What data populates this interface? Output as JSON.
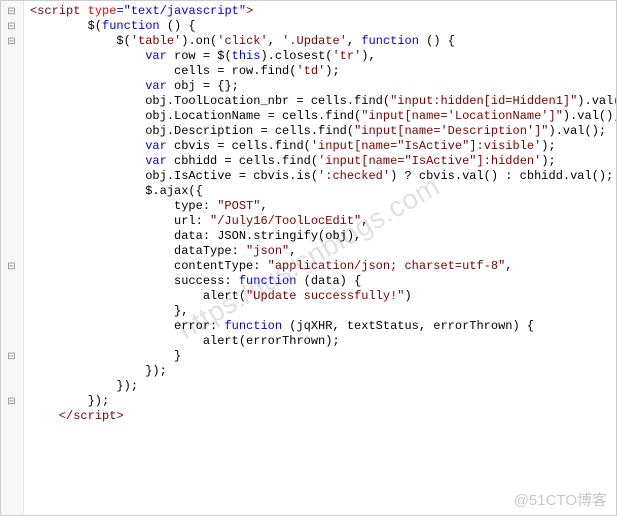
{
  "folds": [
    "⊟",
    "⊟",
    "⊟",
    "",
    "",
    "",
    "",
    "",
    "",
    "",
    "",
    "",
    "",
    "",
    "",
    "",
    "",
    "⊟",
    "",
    "",
    "",
    "",
    "",
    "⊟",
    "",
    "",
    "⊟",
    "",
    "",
    "",
    "",
    "",
    ""
  ],
  "code": {
    "l1": {
      "a": "<",
      "b": "script",
      "c": " ",
      "d": "type",
      "e": "=\"text/javascript\"",
      "f": ">"
    },
    "l2": {
      "a": "        $(",
      "b": "function",
      "c": " () {"
    },
    "l3": {
      "a": "            $(",
      "b": "'table'",
      "c": ").on(",
      "d": "'click'",
      "e": ", ",
      "f": "'.Update'",
      "g": ", ",
      "h": "function",
      "i": " () {"
    },
    "l4": {
      "a": "                ",
      "b": "var",
      "c": " row = $(",
      "d": "this",
      "e": ").closest(",
      "f": "'tr'",
      "g": "),"
    },
    "l5": {
      "a": "                    cells = row.find(",
      "b": "'td'",
      "c": ");"
    },
    "l6": "",
    "l7": {
      "a": "                ",
      "b": "var",
      "c": " obj = {};"
    },
    "l8": {
      "a": "                obj.ToolLocation_nbr = cells.find(",
      "b": "\"input:hidden[id=Hidden1]\"",
      "c": ").val()"
    },
    "l9": "",
    "l10": {
      "a": "                obj.LocationName = cells.find(",
      "b": "\"input[name='LocationName']\"",
      "c": ").val();"
    },
    "l11": {
      "a": "                obj.Description = cells.find(",
      "b": "\"input[name='Description']\"",
      "c": ").val();"
    },
    "l12": "",
    "l13": {
      "a": "                ",
      "b": "var",
      "c": " cbvis = cells.find(",
      "d": "'input[name=\"IsActive\"]:visible'",
      "e": ");"
    },
    "l14": {
      "a": "                ",
      "b": "var",
      "c": " cbhidd = cells.find(",
      "d": "'input[name=\"IsActive\"]:hidden'",
      "e": ");"
    },
    "l15": {
      "a": "                obj.IsActive = cbvis.is(",
      "b": "':checked'",
      "c": ") ? cbvis.val() : cbhidd.val();"
    },
    "l16": "",
    "l17": "                $.ajax({",
    "l18": {
      "a": "                    type: ",
      "b": "\"POST\"",
      "c": ","
    },
    "l19": {
      "a": "                    url: ",
      "b": "\"/July16/ToolLocEdit\"",
      "c": ","
    },
    "l20": "                    data: JSON.stringify(obj),",
    "l21": {
      "a": "                    dataType: ",
      "b": "\"json\"",
      "c": ","
    },
    "l22": {
      "a": "                    contentType: ",
      "b": "\"application/json; charset=utf-8\"",
      "c": ","
    },
    "l23": {
      "a": "                    success: ",
      "b": "function",
      "c": " (data) {"
    },
    "l24": {
      "a": "                        alert(",
      "b": "\"Update successfully!\"",
      "c": ")"
    },
    "l25": "                    },",
    "l26": {
      "a": "                    error: ",
      "b": "function",
      "c": " (jqXHR, textStatus, errorThrown) {"
    },
    "l27": "                        alert(errorThrown);",
    "l28": "                    }",
    "l29": "                });",
    "l30": "            });",
    "l31": "        });",
    "l32": {
      "a": "    </",
      "b": "script",
      "c": ">"
    }
  },
  "watermark": "https://jus.cnblogs.com",
  "attribution": "@51CTO博客"
}
